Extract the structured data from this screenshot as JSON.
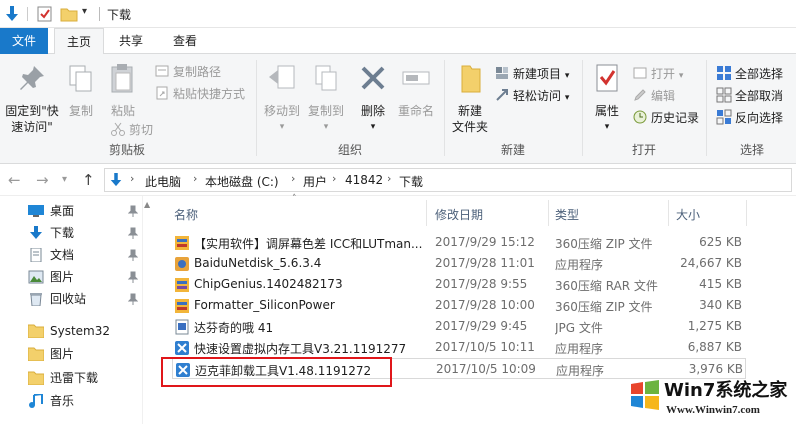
{
  "titlebar": {
    "title": "下载"
  },
  "tabs": [
    {
      "label": "文件"
    },
    {
      "label": "主页"
    },
    {
      "label": "共享"
    },
    {
      "label": "查看"
    }
  ],
  "ribbon": {
    "clipboard": {
      "label": "剪贴板",
      "pin_quick_line1": "固定到\"快",
      "pin_quick_line2": "速访问\"",
      "copy": "复制",
      "paste": "粘贴",
      "copy_path": "复制路径",
      "paste_shortcut": "粘贴快捷方式",
      "cut": "剪切"
    },
    "organize": {
      "label": "组织",
      "move_to": "移动到",
      "copy_to": "复制到",
      "delete": "删除",
      "rename": "重命名"
    },
    "new": {
      "label": "新建",
      "new_folder_line1": "新建",
      "new_folder_line2": "文件夹",
      "new_item": "新建项目",
      "easy_access": "轻松访问"
    },
    "open": {
      "label": "打开",
      "properties": "属性",
      "open": "打开",
      "edit": "编辑",
      "history": "历史记录"
    },
    "select": {
      "label": "选择",
      "select_all": "全部选择",
      "select_none": "全部取消",
      "invert": "反向选择"
    }
  },
  "address": {
    "crumbs": [
      "此电脑",
      "本地磁盘 (C:)",
      "用户",
      "41842",
      "下载"
    ]
  },
  "nav": [
    {
      "label": "桌面",
      "pinned": true
    },
    {
      "label": "下载",
      "pinned": true
    },
    {
      "label": "文档",
      "pinned": true
    },
    {
      "label": "图片",
      "pinned": true
    },
    {
      "label": "回收站",
      "pinned": true
    },
    {
      "label": "System32",
      "pinned": false
    },
    {
      "label": "图片",
      "pinned": false
    },
    {
      "label": "迅雷下载",
      "pinned": false
    },
    {
      "label": "音乐",
      "pinned": false
    }
  ],
  "columns": {
    "name": "名称",
    "date": "修改日期",
    "type": "类型",
    "size": "大小"
  },
  "files": [
    {
      "name": "【实用软件】调屏幕色差 ICC和LUTman...",
      "date": "2017/9/29 15:12",
      "type": "360压缩 ZIP 文件",
      "size": "625 KB",
      "icon": "zip-icon"
    },
    {
      "name": "BaiduNetdisk_5.6.3.4",
      "date": "2017/9/28 11:01",
      "type": "应用程序",
      "size": "24,667 KB",
      "icon": "app-icon"
    },
    {
      "name": "ChipGenius.1402482173",
      "date": "2017/9/28 9:55",
      "type": "360压缩 RAR 文件",
      "size": "415 KB",
      "icon": "rar-icon"
    },
    {
      "name": "Formatter_SiliconPower",
      "date": "2017/9/28 10:00",
      "type": "360压缩 ZIP 文件",
      "size": "340 KB",
      "icon": "zip-icon"
    },
    {
      "name": "达芬奇的哦 41",
      "date": "2017/9/29 9:45",
      "type": "JPG 文件",
      "size": "1,275 KB",
      "icon": "jpg-icon"
    },
    {
      "name": "快速设置虚拟内存工具V3.21.1191277",
      "date": "2017/10/5 10:11",
      "type": "应用程序",
      "size": "6,887 KB",
      "icon": "tool-icon"
    },
    {
      "name": "迈克菲卸载工具V1.48.1191272",
      "date": "2017/10/5 10:09",
      "type": "应用程序",
      "size": "3,976 KB",
      "icon": "tool-icon"
    }
  ],
  "watermark": {
    "line1": "Win7系统之家",
    "line2": "Www.Winwin7.com"
  },
  "colors": {
    "file_tab": "#1979ca",
    "highlight": "#e0161a",
    "header_text": "#4c607a"
  }
}
